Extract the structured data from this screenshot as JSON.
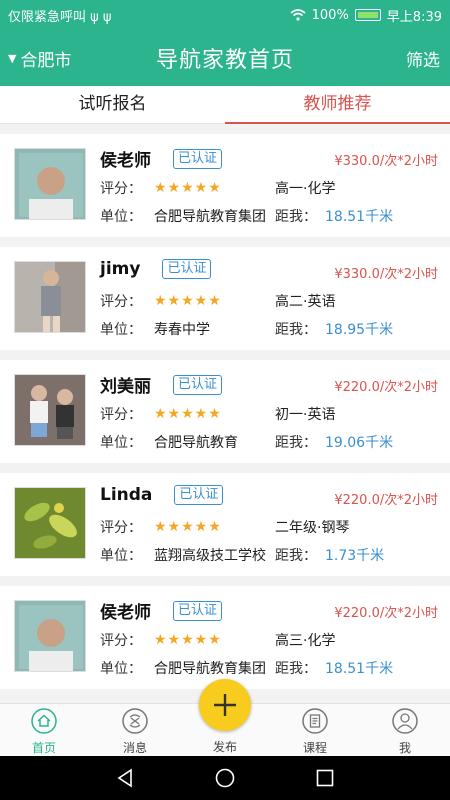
{
  "statusbar": {
    "left_text": "仅限紧急呼叫 ψ ψ",
    "battery": "100%",
    "time": "早上8:39"
  },
  "header": {
    "city": "合肥市",
    "title": "导航家教首页",
    "filter": "筛选"
  },
  "tabs": [
    {
      "label": "试听报名",
      "active": false
    },
    {
      "label": "教师推荐",
      "active": true
    }
  ],
  "labels": {
    "rating": "评分：",
    "unit": "单位：",
    "distance": "距我：",
    "verified": "已认证"
  },
  "teachers": [
    {
      "name": "侯老师",
      "price": "¥330.0/次*2小时",
      "stars": 5,
      "stars_text": "★★★★★",
      "grade": "高一·化学",
      "unit": "合肥导航教育集团",
      "distance": "18.51千米"
    },
    {
      "name": "jimy",
      "price": "¥330.0/次*2小时",
      "stars": 5,
      "stars_text": "★★★★★",
      "grade": "高二·英语",
      "unit": "寿春中学",
      "distance": "18.95千米"
    },
    {
      "name": "刘美丽",
      "price": "¥220.0/次*2小时",
      "stars": 5,
      "stars_text": "★★★★★",
      "grade": "初一·英语",
      "unit": "合肥导航教育",
      "distance": "19.06千米"
    },
    {
      "name": "Linda",
      "price": "¥220.0/次*2小时",
      "stars": 5,
      "stars_text": "★★★★★",
      "grade": "二年级·钢琴",
      "unit": "蓝翔高级技工学校",
      "distance": "1.73千米"
    },
    {
      "name": "侯老师",
      "price": "¥220.0/次*2小时",
      "stars": 5,
      "stars_text": "★★★★★",
      "grade": "高三·化学",
      "unit": "合肥导航教育集团",
      "distance": "18.51千米"
    }
  ],
  "tabbar": {
    "home": "首页",
    "messages": "消息",
    "publish": "发布",
    "courses": "课程",
    "me": "我"
  },
  "colors": {
    "primary": "#2bb48e",
    "accent_red": "#d9534f",
    "link_blue": "#3a8fd1",
    "star": "#f5a623",
    "fab": "#f7cc1f"
  }
}
